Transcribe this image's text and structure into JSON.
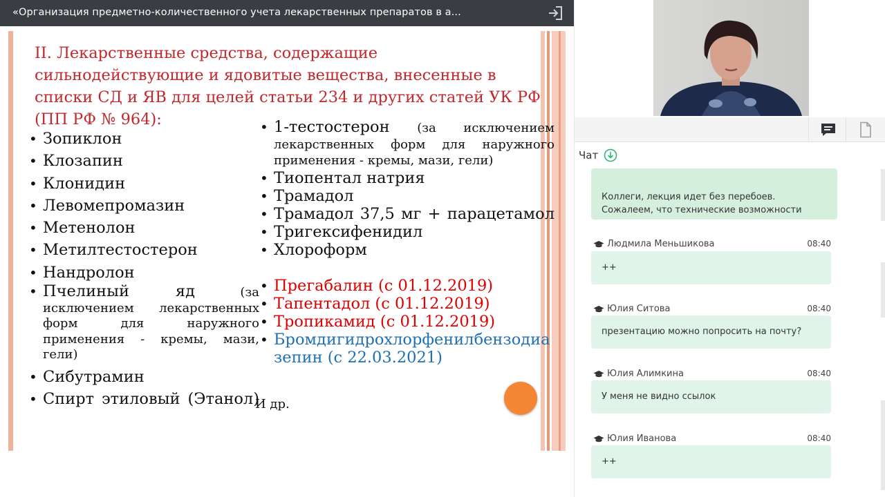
{
  "window": {
    "title": "«Организация предметно-количественного учета лекарственных препаратов в а..."
  },
  "slide": {
    "heading": "II. Лекарственные средства, содержащие сильнодействующие и ядовитые вещества, внесенные в списки СД и ЯВ для целей статьи 234 и других статей УК РФ (ПП РФ № 964):",
    "left_list": [
      "Зопиклон",
      "Клозапин",
      "Клонидин",
      "Левомепромазин",
      "Метенолон",
      "Метилтестостерон",
      "Нандролон"
    ],
    "left_bee_title": "Пчелиный яд",
    "left_bee_note": "(за исключением лекарственных форм для наружного применения - кремы, мази, гели)",
    "left_list_2": [
      "Сибутрамин",
      "Спирт этиловый (Этанол)"
    ],
    "right_first_title": "1-тестостерон",
    "right_first_note": "(за исключением лекарственных форм для наружного применения - кремы, мази, гели)",
    "right_list": [
      "Тиопентал натрия",
      "Трамадол",
      "Трамадол 37,5 мг + парацетамол",
      "Тригексифенидил",
      "Хлороформ"
    ],
    "right_red": [
      "Прегабалин (с 01.12.2019)",
      "Тапентадол (с 01.12.2019)",
      "Тропикамид (с 01.12.2019)"
    ],
    "right_blue": "Бромдигидрохлорфенилбензодиазепин (с 22.03.2021)",
    "etc": "И др."
  },
  "chat": {
    "title": "Чат",
    "pinned": "Коллеги, лекция идет без перебоев. Сожалеем, что технические возможности",
    "messages": [
      {
        "author": "Людмила Меньшикова",
        "time": "08:40",
        "text": "++"
      },
      {
        "author": "Юлия Ситова",
        "time": "08:40",
        "text": "презентацию можно попросить на почту?"
      },
      {
        "author": "Юлия Алимкина",
        "time": "08:40",
        "text": "У меня не видно ссылок"
      },
      {
        "author": "Юлия Иванова",
        "time": "08:40",
        "text": "++"
      }
    ]
  },
  "icons": {
    "exit": "exit-icon",
    "chat": "chat-icon",
    "file": "document-icon",
    "download": "download-circle-icon",
    "role": "graduation-cap-icon"
  },
  "colors": {
    "titlebar": "#3a3d42",
    "heading_red": "#c0282d",
    "list_red": "#e00000",
    "list_blue": "#1f6fb4",
    "pointer": "#f58635",
    "bubble": "#e1f4ea",
    "download_icon": "#2bb673"
  }
}
